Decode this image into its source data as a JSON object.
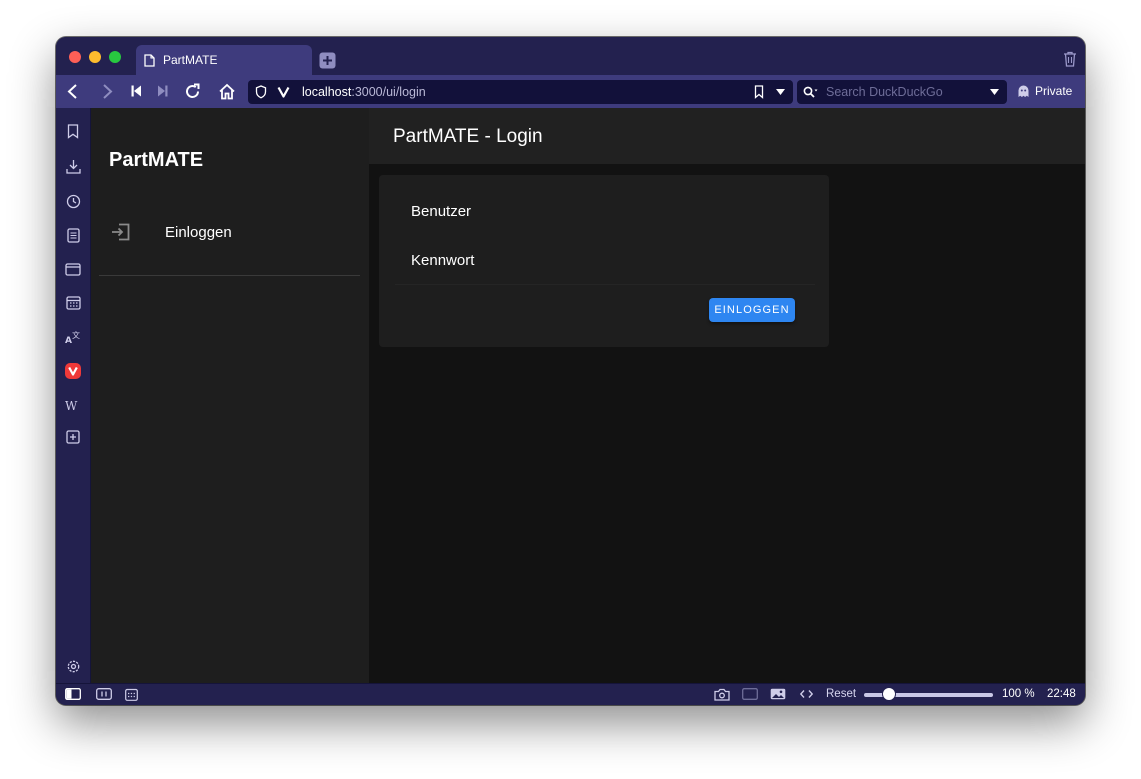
{
  "browser": {
    "tab_title": "PartMATE",
    "url_host": "localhost",
    "url_path": ":3000/ui/login",
    "search_placeholder": "Search DuckDuckGo",
    "private_label": "Private",
    "zoom_reset_label": "Reset",
    "zoom_level_label": "100 %",
    "zoom_fraction": 0.2,
    "clock": "22:48",
    "accent_color": "#23214f"
  },
  "app": {
    "drawer_title": "PartMATE",
    "drawer_items": [
      {
        "label": "Einloggen",
        "icon": "login-icon"
      }
    ],
    "appbar_title": "PartMATE - Login",
    "login_form": {
      "user_label": "Benutzer",
      "password_label": "Kennwort",
      "submit_label": "EINLOGGEN",
      "button_color": "#2e86f1"
    }
  }
}
